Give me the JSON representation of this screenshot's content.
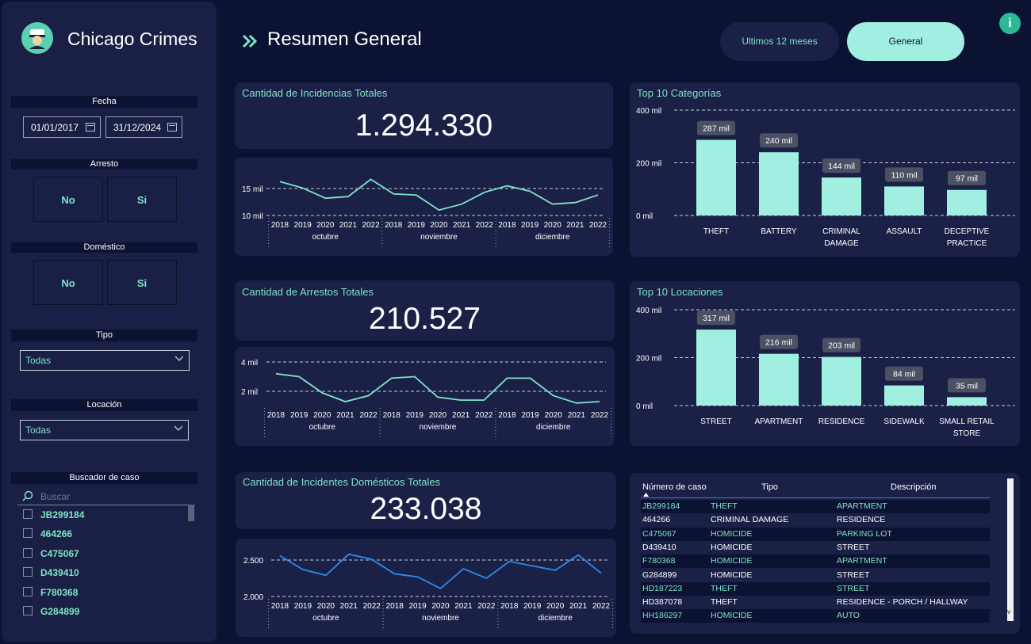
{
  "app": {
    "title": "Chicago Crimes",
    "page_title": "Resumen General"
  },
  "toggles": {
    "last12": "Ultimos 12 meses",
    "general": "General"
  },
  "filters": {
    "fecha": {
      "label": "Fecha",
      "from": "01/01/2017",
      "to": "31/12/2024"
    },
    "arresto": {
      "label": "Arresto",
      "no": "No",
      "si": "Si"
    },
    "domestico": {
      "label": "Doméstico",
      "no": "No",
      "si": "Si"
    },
    "tipo": {
      "label": "Tipo",
      "value": "Todas"
    },
    "locacion": {
      "label": "Locación",
      "value": "Todas"
    },
    "buscador": {
      "label": "Buscador de caso",
      "placeholder": "Buscar",
      "items": [
        "JB299184",
        "464266",
        "C475067",
        "D439410",
        "F780368",
        "G284899"
      ]
    }
  },
  "kpis": {
    "incidencias": {
      "title": "Cantidad de Incidencias Totales",
      "value": "1.294.330"
    },
    "arrestos": {
      "title": "Cantidad de Arrestos Totales",
      "value": "210.527"
    },
    "domesticos": {
      "title": "Cantidad de Incidentes Domésticos Totales",
      "value": "233.038"
    }
  },
  "colors": {
    "accent": "#7fe3c8",
    "bar": "#a0efe0",
    "line_teal": "#7fe3c8",
    "line_blue": "#2b8ce6",
    "bg": "#0c1231",
    "card": "#1b2146"
  },
  "chart_data": [
    {
      "type": "line",
      "title": "",
      "x_years": [
        "2018",
        "2019",
        "2020",
        "2021",
        "2022"
      ],
      "groups": [
        "octubre",
        "noviembre",
        "diciembre"
      ],
      "y_ticks": [
        "15 mil",
        "10 mil"
      ],
      "y_tick_values": [
        15000,
        10000
      ],
      "values": [
        16300,
        15100,
        13200,
        13500,
        16700,
        14000,
        13800,
        11000,
        12100,
        14300,
        15500,
        14500,
        12100,
        12400,
        13800
      ]
    },
    {
      "type": "line",
      "title": "",
      "x_years": [
        "2018",
        "2019",
        "2020",
        "2021",
        "2022"
      ],
      "groups": [
        "octubre",
        "noviembre",
        "diciembre"
      ],
      "y_ticks": [
        "4 mil",
        "2 mil"
      ],
      "y_tick_values": [
        4000,
        2000
      ],
      "values": [
        3200,
        3000,
        1900,
        1300,
        1700,
        2900,
        3000,
        1600,
        1400,
        1400,
        2900,
        2900,
        1700,
        1200,
        1300
      ]
    },
    {
      "type": "line",
      "title": "",
      "x_years": [
        "2018",
        "2019",
        "2020",
        "2021",
        "2022"
      ],
      "groups": [
        "octubre",
        "noviembre",
        "diciembre"
      ],
      "y_ticks": [
        "2.500",
        "2.000"
      ],
      "y_tick_values": [
        2500,
        2000
      ],
      "values": [
        2560,
        2370,
        2290,
        2580,
        2510,
        2310,
        2270,
        2110,
        2380,
        2250,
        2480,
        2420,
        2360,
        2570,
        2320
      ]
    },
    {
      "type": "bar",
      "title": "Top 10 Categorías",
      "categories": [
        "THEFT",
        "BATTERY",
        "CRIMINAL DAMAGE",
        "ASSAULT",
        "DECEPTIVE PRACTICE"
      ],
      "values": [
        287,
        240,
        144,
        110,
        97
      ],
      "labels": [
        "287 mil",
        "240 mil",
        "144 mil",
        "110 mil",
        "97 mil"
      ],
      "y_ticks": [
        "400 mil",
        "200 mil",
        "0 mil"
      ],
      "ylim": [
        0,
        400
      ]
    },
    {
      "type": "bar",
      "title": "Top 10 Locaciones",
      "categories": [
        "STREET",
        "APARTMENT",
        "RESIDENCE",
        "SIDEWALK",
        "SMALL RETAIL STORE"
      ],
      "values": [
        317,
        216,
        203,
        84,
        35
      ],
      "labels": [
        "317 mil",
        "216 mil",
        "203 mil",
        "84 mil",
        "35 mil"
      ],
      "y_ticks": [
        "400 mil",
        "200 mil",
        "0 mil"
      ],
      "ylim": [
        0,
        400
      ]
    }
  ],
  "table": {
    "headers": [
      "Número de caso",
      "Tipo",
      "Descripción"
    ],
    "rows": [
      [
        "JB299184",
        "THEFT",
        "APARTMENT"
      ],
      [
        "464266",
        "CRIMINAL DAMAGE",
        "RESIDENCE"
      ],
      [
        "C475067",
        "HOMICIDE",
        "PARKING LOT"
      ],
      [
        "D439410",
        "HOMICIDE",
        "STREET"
      ],
      [
        "F780368",
        "HOMICIDE",
        "APARTMENT"
      ],
      [
        "G284899",
        "HOMICIDE",
        "STREET"
      ],
      [
        "HD187223",
        "THEFT",
        "STREET"
      ],
      [
        "HD387078",
        "THEFT",
        "RESIDENCE - PORCH / HALLWAY"
      ],
      [
        "HH186297",
        "HOMICIDE",
        "AUTO"
      ]
    ]
  }
}
